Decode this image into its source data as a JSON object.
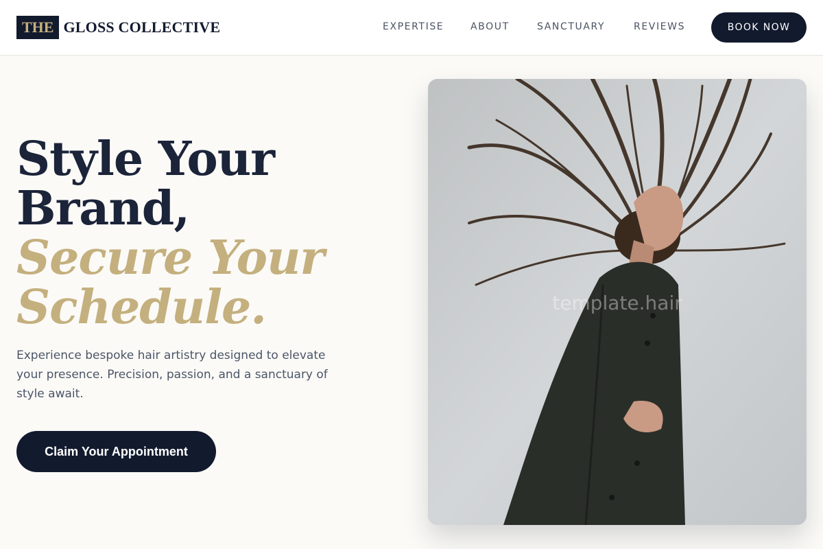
{
  "header": {
    "logo_mark": "THE",
    "logo_text": "GLOSS COLLECTIVE",
    "nav": [
      "EXPERTISE",
      "ABOUT",
      "SANCTUARY",
      "REVIEWS"
    ],
    "book_label": "BOOK NOW"
  },
  "hero": {
    "headline_line1": "Style Your",
    "headline_line2": "Brand,",
    "headline_line3": "Secure Your",
    "headline_line4": "Schedule.",
    "description": "Experience bespoke hair artistry designed to elevate your presence. Precision, passion, and a sanctuary of style await.",
    "cta_label": "Claim Your Appointment"
  },
  "photo": {
    "watermark": "template.hair"
  },
  "colors": {
    "navy": "#121a2e",
    "gold": "#c4b07e",
    "background": "#fbfaf7"
  }
}
